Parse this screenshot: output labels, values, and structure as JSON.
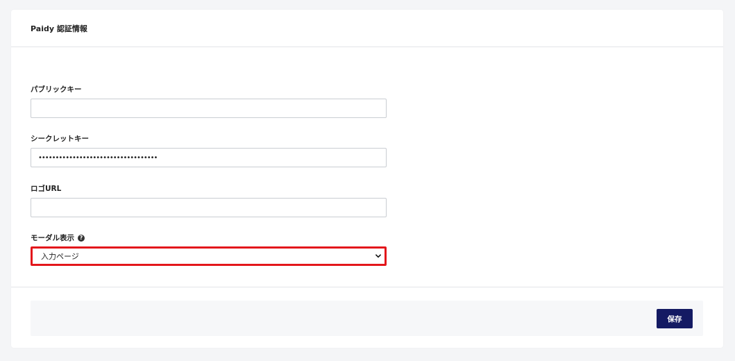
{
  "section": {
    "title": "Paidy 認証情報"
  },
  "fields": {
    "public_key": {
      "label": "パブリックキー",
      "value": ""
    },
    "secret_key": {
      "label": "シークレットキー",
      "value": "•••••••••••••••••••••••••••••••••••"
    },
    "logo_url": {
      "label": "ロゴURL",
      "value": ""
    },
    "modal_display": {
      "label": "モーダル表示",
      "help_icon": "question-circle-icon",
      "selected": "入力ページ"
    }
  },
  "footer": {
    "save_label": "保存"
  },
  "colors": {
    "primary_button": "#141a63",
    "highlight_border": "#e3161b",
    "page_background": "#f4f5f7"
  }
}
